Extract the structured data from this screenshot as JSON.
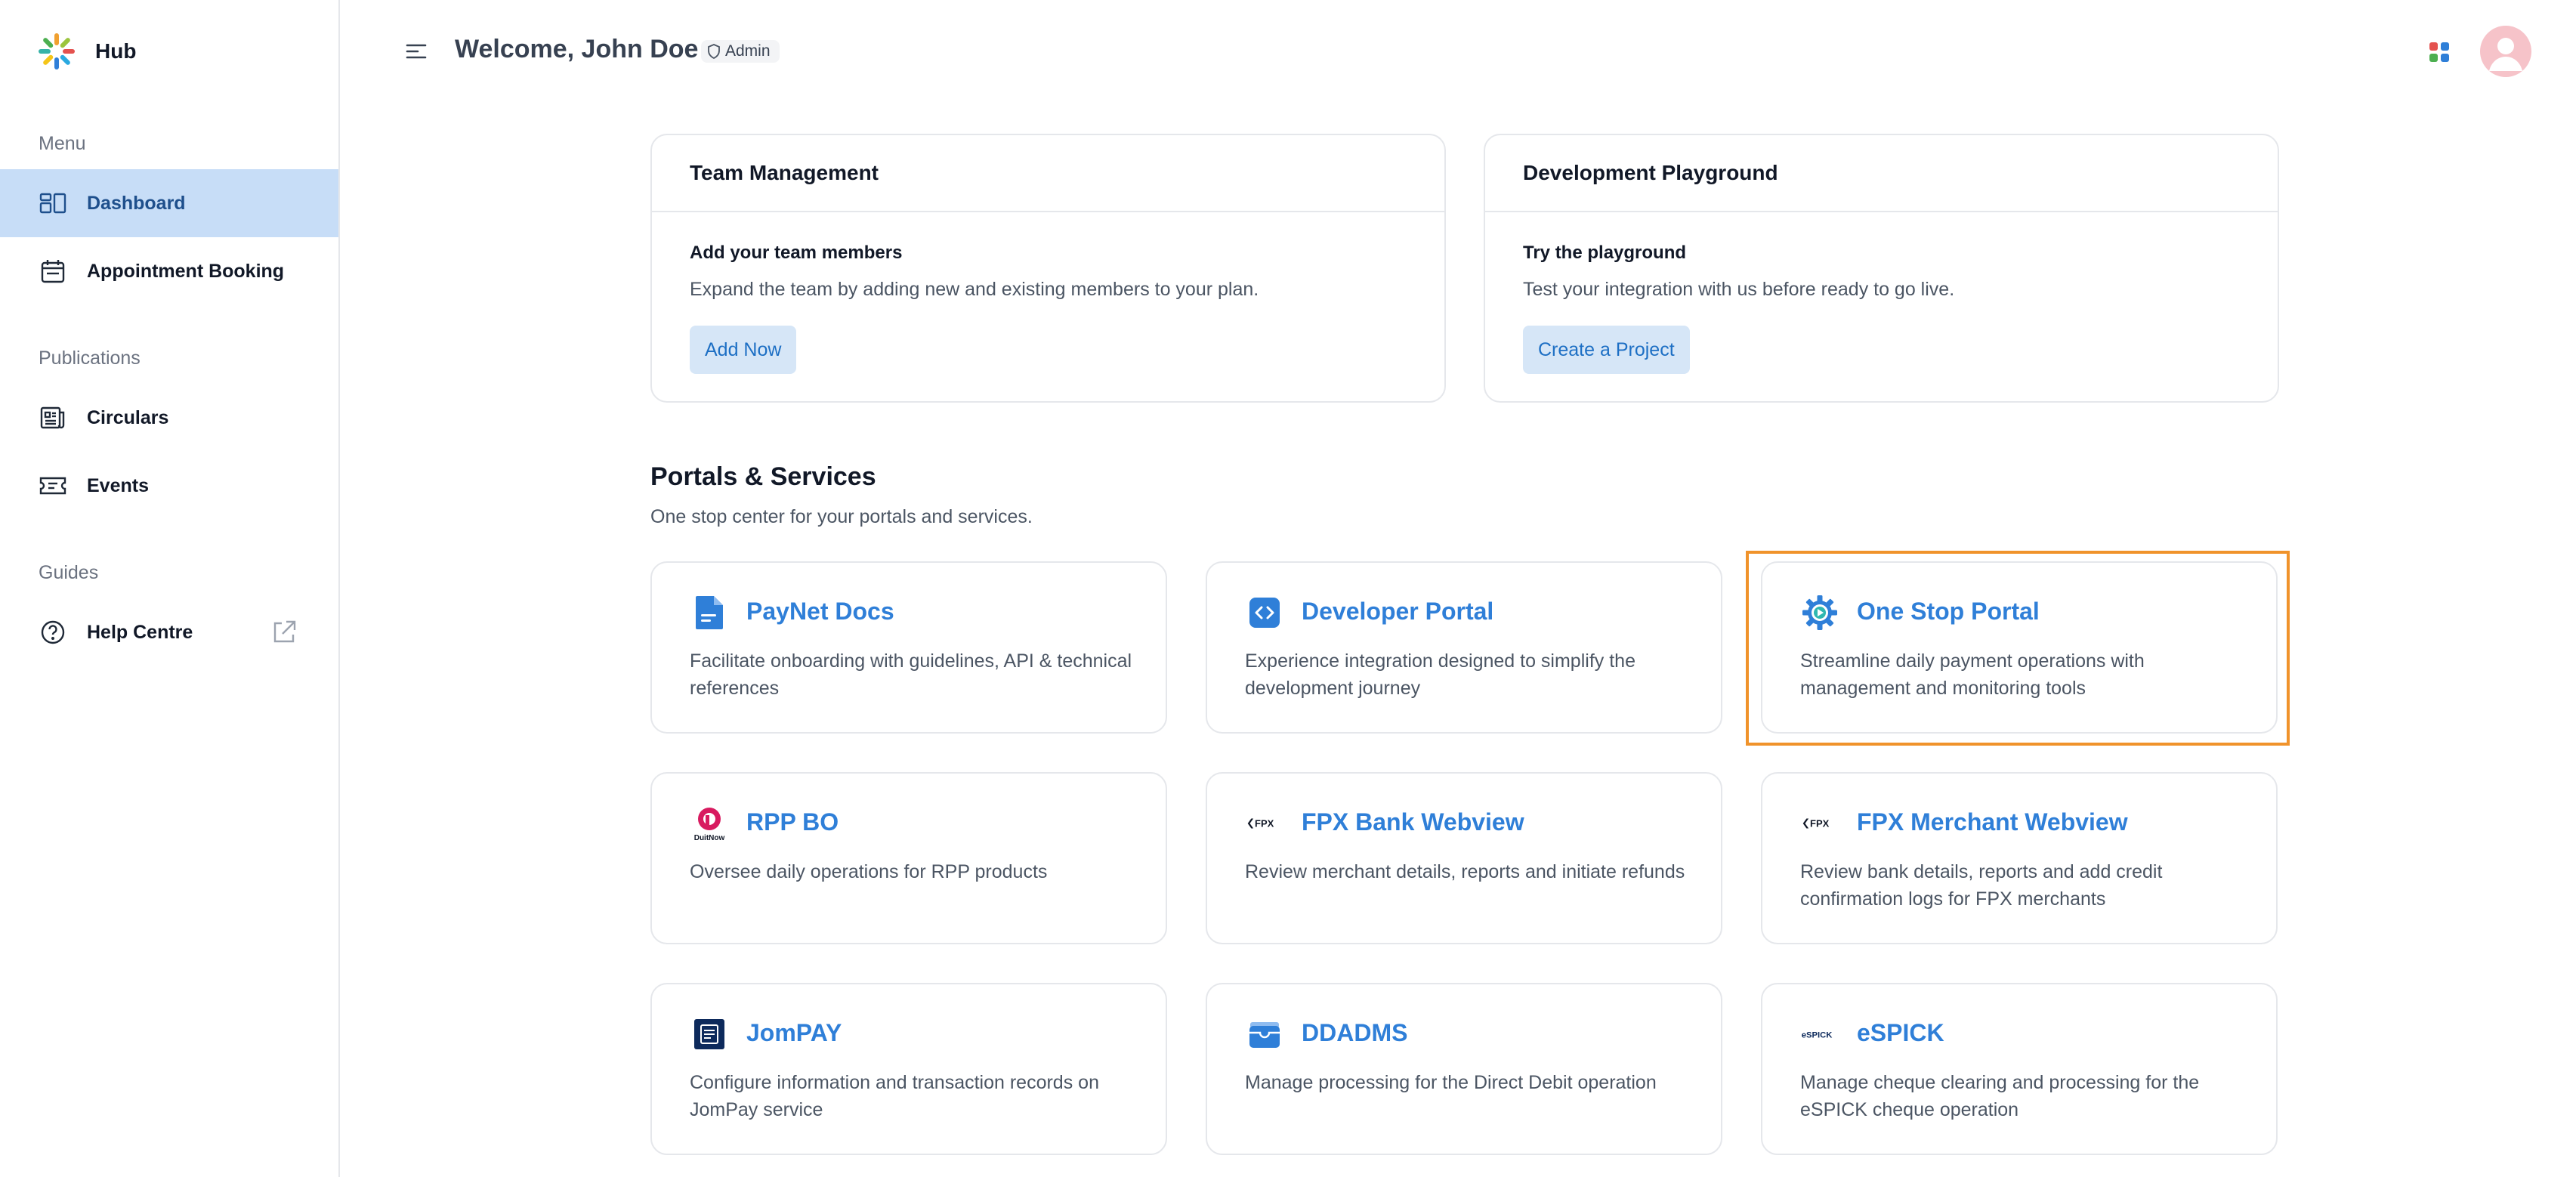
{
  "app": {
    "name": "Hub"
  },
  "header": {
    "welcome": "Welcome, John Doe",
    "role": "Admin"
  },
  "sidebar": {
    "sections": {
      "menu": "Menu",
      "publications": "Publications",
      "guides": "Guides"
    },
    "items": [
      {
        "label": "Dashboard",
        "icon": "dashboard-icon",
        "active": true
      },
      {
        "label": "Appointment Booking",
        "icon": "calendar-icon",
        "active": false
      },
      {
        "label": "Circulars",
        "icon": "newspaper-icon",
        "active": false
      },
      {
        "label": "Events",
        "icon": "ticket-icon",
        "active": false
      },
      {
        "label": "Help Centre",
        "icon": "help-circle-icon",
        "active": false
      }
    ]
  },
  "top_cards": [
    {
      "title": "Team Management",
      "heading": "Add your team members",
      "description": "Expand the team by adding new and existing members to your plan.",
      "button": "Add Now"
    },
    {
      "title": "Development Playground",
      "heading": "Try the playground",
      "description": "Test your integration with us before ready to go live.",
      "button": "Create a Project"
    }
  ],
  "portals": {
    "title": "Portals & Services",
    "subtitle": "One stop center for your portals and services.",
    "items": [
      {
        "title": "PayNet Docs",
        "description": "Facilitate onboarding with guidelines, API & technical references",
        "icon": "document-icon"
      },
      {
        "title": "Developer Portal",
        "description": "Experience integration designed to simplify the development journey",
        "icon": "code-icon"
      },
      {
        "title": "One Stop Portal",
        "description": "Streamline daily payment operations with management and monitoring tools",
        "icon": "gear-icon",
        "highlighted": true
      },
      {
        "title": "RPP BO",
        "description": "Oversee daily operations for RPP products",
        "icon": "duitnow-icon",
        "icon_text": "DuitNow"
      },
      {
        "title": "FPX Bank Webview",
        "description": "Review merchant details, reports and initiate refunds",
        "icon": "fpx-icon",
        "icon_text": "FPX"
      },
      {
        "title": "FPX Merchant Webview",
        "description": "Review bank details, reports and add credit confirmation logs for FPX merchants",
        "icon": "fpx-icon",
        "icon_text": "FPX"
      },
      {
        "title": "JomPAY",
        "description": "Configure information and transaction records on JomPay service",
        "icon": "jompay-icon"
      },
      {
        "title": "DDADMS",
        "description": "Manage processing for the Direct Debit operation",
        "icon": "wallet-icon"
      },
      {
        "title": "eSPICK",
        "description": "Manage cheque clearing and processing for the eSPICK cheque operation",
        "icon": "espick-icon",
        "icon_text": "eSPICK"
      }
    ]
  },
  "colors": {
    "accent": "#2f7fd8",
    "active_nav_bg": "#c7ddf7",
    "highlight_border": "#f0932b"
  }
}
